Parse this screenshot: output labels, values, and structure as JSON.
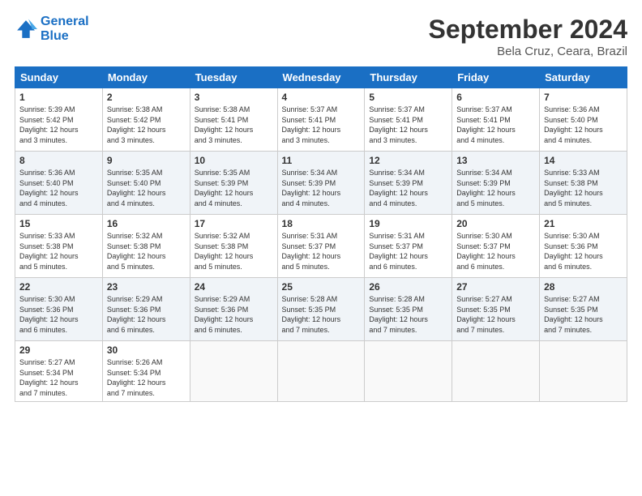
{
  "header": {
    "logo_line1": "General",
    "logo_line2": "Blue",
    "month_title": "September 2024",
    "location": "Bela Cruz, Ceara, Brazil"
  },
  "days_of_week": [
    "Sunday",
    "Monday",
    "Tuesday",
    "Wednesday",
    "Thursday",
    "Friday",
    "Saturday"
  ],
  "weeks": [
    [
      {
        "day": "1",
        "info": "Sunrise: 5:39 AM\nSunset: 5:42 PM\nDaylight: 12 hours\nand 3 minutes."
      },
      {
        "day": "2",
        "info": "Sunrise: 5:38 AM\nSunset: 5:42 PM\nDaylight: 12 hours\nand 3 minutes."
      },
      {
        "day": "3",
        "info": "Sunrise: 5:38 AM\nSunset: 5:41 PM\nDaylight: 12 hours\nand 3 minutes."
      },
      {
        "day": "4",
        "info": "Sunrise: 5:37 AM\nSunset: 5:41 PM\nDaylight: 12 hours\nand 3 minutes."
      },
      {
        "day": "5",
        "info": "Sunrise: 5:37 AM\nSunset: 5:41 PM\nDaylight: 12 hours\nand 3 minutes."
      },
      {
        "day": "6",
        "info": "Sunrise: 5:37 AM\nSunset: 5:41 PM\nDaylight: 12 hours\nand 4 minutes."
      },
      {
        "day": "7",
        "info": "Sunrise: 5:36 AM\nSunset: 5:40 PM\nDaylight: 12 hours\nand 4 minutes."
      }
    ],
    [
      {
        "day": "8",
        "info": "Sunrise: 5:36 AM\nSunset: 5:40 PM\nDaylight: 12 hours\nand 4 minutes."
      },
      {
        "day": "9",
        "info": "Sunrise: 5:35 AM\nSunset: 5:40 PM\nDaylight: 12 hours\nand 4 minutes."
      },
      {
        "day": "10",
        "info": "Sunrise: 5:35 AM\nSunset: 5:39 PM\nDaylight: 12 hours\nand 4 minutes."
      },
      {
        "day": "11",
        "info": "Sunrise: 5:34 AM\nSunset: 5:39 PM\nDaylight: 12 hours\nand 4 minutes."
      },
      {
        "day": "12",
        "info": "Sunrise: 5:34 AM\nSunset: 5:39 PM\nDaylight: 12 hours\nand 4 minutes."
      },
      {
        "day": "13",
        "info": "Sunrise: 5:34 AM\nSunset: 5:39 PM\nDaylight: 12 hours\nand 5 minutes."
      },
      {
        "day": "14",
        "info": "Sunrise: 5:33 AM\nSunset: 5:38 PM\nDaylight: 12 hours\nand 5 minutes."
      }
    ],
    [
      {
        "day": "15",
        "info": "Sunrise: 5:33 AM\nSunset: 5:38 PM\nDaylight: 12 hours\nand 5 minutes."
      },
      {
        "day": "16",
        "info": "Sunrise: 5:32 AM\nSunset: 5:38 PM\nDaylight: 12 hours\nand 5 minutes."
      },
      {
        "day": "17",
        "info": "Sunrise: 5:32 AM\nSunset: 5:38 PM\nDaylight: 12 hours\nand 5 minutes."
      },
      {
        "day": "18",
        "info": "Sunrise: 5:31 AM\nSunset: 5:37 PM\nDaylight: 12 hours\nand 5 minutes."
      },
      {
        "day": "19",
        "info": "Sunrise: 5:31 AM\nSunset: 5:37 PM\nDaylight: 12 hours\nand 6 minutes."
      },
      {
        "day": "20",
        "info": "Sunrise: 5:30 AM\nSunset: 5:37 PM\nDaylight: 12 hours\nand 6 minutes."
      },
      {
        "day": "21",
        "info": "Sunrise: 5:30 AM\nSunset: 5:36 PM\nDaylight: 12 hours\nand 6 minutes."
      }
    ],
    [
      {
        "day": "22",
        "info": "Sunrise: 5:30 AM\nSunset: 5:36 PM\nDaylight: 12 hours\nand 6 minutes."
      },
      {
        "day": "23",
        "info": "Sunrise: 5:29 AM\nSunset: 5:36 PM\nDaylight: 12 hours\nand 6 minutes."
      },
      {
        "day": "24",
        "info": "Sunrise: 5:29 AM\nSunset: 5:36 PM\nDaylight: 12 hours\nand 6 minutes."
      },
      {
        "day": "25",
        "info": "Sunrise: 5:28 AM\nSunset: 5:35 PM\nDaylight: 12 hours\nand 7 minutes."
      },
      {
        "day": "26",
        "info": "Sunrise: 5:28 AM\nSunset: 5:35 PM\nDaylight: 12 hours\nand 7 minutes."
      },
      {
        "day": "27",
        "info": "Sunrise: 5:27 AM\nSunset: 5:35 PM\nDaylight: 12 hours\nand 7 minutes."
      },
      {
        "day": "28",
        "info": "Sunrise: 5:27 AM\nSunset: 5:35 PM\nDaylight: 12 hours\nand 7 minutes."
      }
    ],
    [
      {
        "day": "29",
        "info": "Sunrise: 5:27 AM\nSunset: 5:34 PM\nDaylight: 12 hours\nand 7 minutes."
      },
      {
        "day": "30",
        "info": "Sunrise: 5:26 AM\nSunset: 5:34 PM\nDaylight: 12 hours\nand 7 minutes."
      },
      {
        "day": "",
        "info": ""
      },
      {
        "day": "",
        "info": ""
      },
      {
        "day": "",
        "info": ""
      },
      {
        "day": "",
        "info": ""
      },
      {
        "day": "",
        "info": ""
      }
    ]
  ]
}
